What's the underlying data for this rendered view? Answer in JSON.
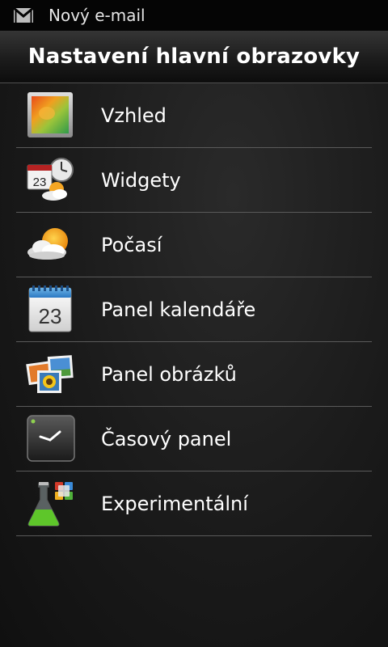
{
  "status_bar": {
    "notification": "Nový e-mail",
    "notification_icon": "gmail-icon"
  },
  "header": {
    "title": "Nastavení hlavní obrazovky"
  },
  "menu": {
    "items": [
      {
        "label": "Vzhled",
        "icon": "appearance-icon"
      },
      {
        "label": "Widgety",
        "icon": "widgets-icon"
      },
      {
        "label": "Počasí",
        "icon": "weather-icon"
      },
      {
        "label": "Panel kalendáře",
        "icon": "calendar-icon",
        "calendar_day": "23"
      },
      {
        "label": "Panel obrázků",
        "icon": "pictures-icon"
      },
      {
        "label": "Časový panel",
        "icon": "clock-icon"
      },
      {
        "label": "Experimentální",
        "icon": "flask-icon"
      }
    ],
    "widget_calendar_day": "23"
  },
  "colors": {
    "background": "#141414",
    "divider": "#5a5a5a",
    "text": "#ffffff"
  }
}
